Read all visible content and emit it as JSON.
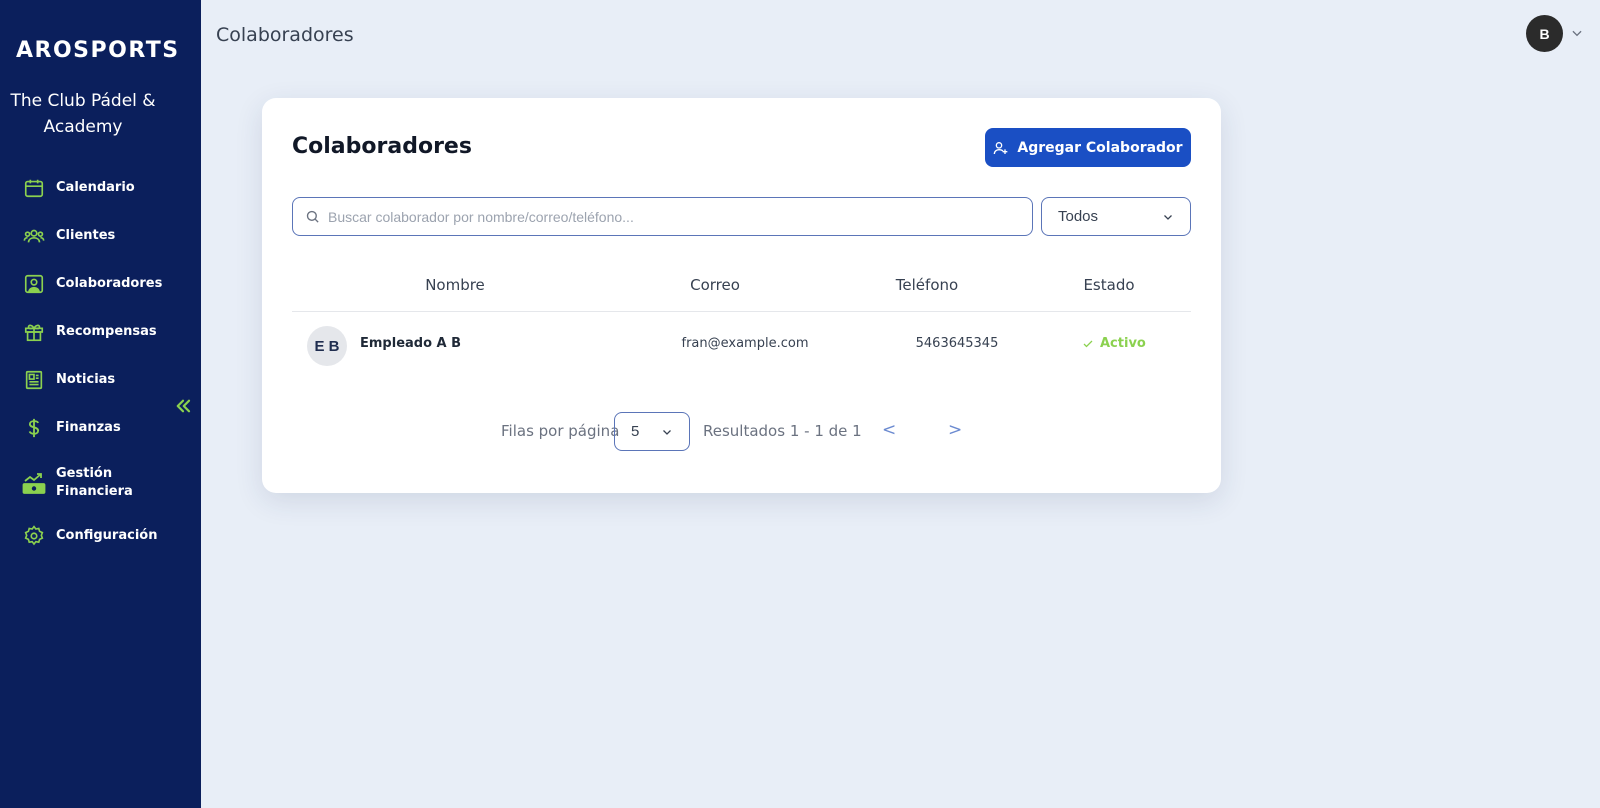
{
  "brand": {
    "logo_text": "AROSPORTS",
    "club_name": "The Club Pádel & Academy"
  },
  "colors": {
    "sidebar": "#0b1f5c",
    "accent": "#8bd14f",
    "primary": "#1a4fc4",
    "background": "#e8eef7"
  },
  "sidebar": {
    "items": [
      {
        "label": "Calendario",
        "icon": "calendar-icon"
      },
      {
        "label": "Clientes",
        "icon": "users-icon"
      },
      {
        "label": "Colaboradores",
        "icon": "user-card-icon"
      },
      {
        "label": "Recompensas",
        "icon": "gift-icon"
      },
      {
        "label": "Noticias",
        "icon": "newspaper-icon"
      },
      {
        "label": "Finanzas",
        "icon": "dollar-icon"
      },
      {
        "label": "Gestión Financiera",
        "icon": "money-chart-icon"
      },
      {
        "label": "Configuración",
        "icon": "gear-icon"
      }
    ],
    "collapse_icon": "double-chevron-left-icon"
  },
  "header": {
    "title": "Colaboradores",
    "user_initial": "B"
  },
  "main": {
    "title": "Colaboradores",
    "add_button": "Agregar Colaborador",
    "search_placeholder": "Buscar colaborador por nombre/correo/teléfono...",
    "filter_value": "Todos",
    "columns": [
      "Nombre",
      "Correo",
      "Teléfono",
      "Estado"
    ],
    "rows": [
      {
        "initials": "E B",
        "name": "Empleado A B",
        "email": "fran@example.com",
        "phone": "5463645345",
        "status": "Activo"
      }
    ],
    "pagination": {
      "rows_label": "Filas por página",
      "rows_value": "5",
      "results": "Resultados 1 - 1 de 1",
      "prev": "<",
      "next": ">"
    }
  }
}
